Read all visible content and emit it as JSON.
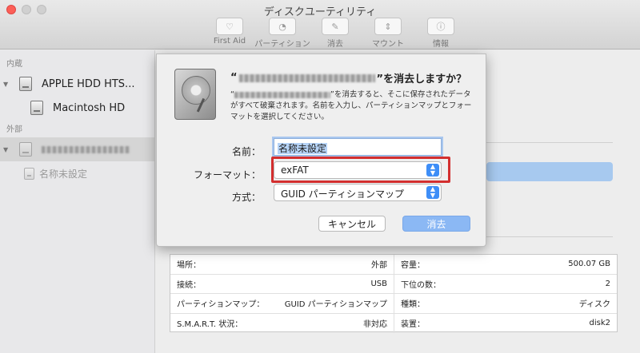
{
  "window": {
    "title": "ディスクユーティリティ"
  },
  "toolbar": {
    "items": [
      {
        "label": "First Aid",
        "icon": "stethoscope-icon"
      },
      {
        "label": "パーティション",
        "icon": "pie-chart-icon"
      },
      {
        "label": "消去",
        "icon": "erase-icon"
      },
      {
        "label": "マウント",
        "icon": "mount-icon"
      },
      {
        "label": "情報",
        "icon": "info-icon"
      }
    ]
  },
  "sidebar": {
    "internal_heading": "内蔵",
    "external_heading": "外部",
    "internal_disk": "APPLE HDD HTS...",
    "internal_volume": "Macintosh HD",
    "external_volume": "名称未設定"
  },
  "dialog": {
    "title_prefix": "“",
    "title_suffix": "”を消去しますか？",
    "message_line1_suffix": "”を消去すると、そこに保存され",
    "message_rest": "たデータがすべて破棄されます。名前を入力し、パーティションマップとフォーマットを選択してください。",
    "message_quote_open": "“",
    "name_label": "名前：",
    "name_value": "名称未設定",
    "format_label": "フォーマット：",
    "format_value": "exFAT",
    "scheme_label": "方式：",
    "scheme_value": "GUID パーティションマップ",
    "cancel_label": "キャンセル",
    "erase_label": "消去"
  },
  "info_table": {
    "rows": [
      {
        "k1": "場所：",
        "v1": "外部",
        "k2": "容量：",
        "v2": "500.07 GB"
      },
      {
        "k1": "接続：",
        "v1": "USB",
        "k2": "下位の数：",
        "v2": "2"
      },
      {
        "k1": "パーティションマップ：",
        "v1": "GUID パーティションマップ",
        "k2": "種類：",
        "v2": "ディスク"
      },
      {
        "k1": "S.M.A.R.T. 状況：",
        "v1": "非対応",
        "k2": "装置：",
        "v2": "disk2"
      }
    ]
  },
  "colors": {
    "accent": "#3e8ef7",
    "highlight": "#d32f2f",
    "erase_button": "#8bb8f4"
  }
}
